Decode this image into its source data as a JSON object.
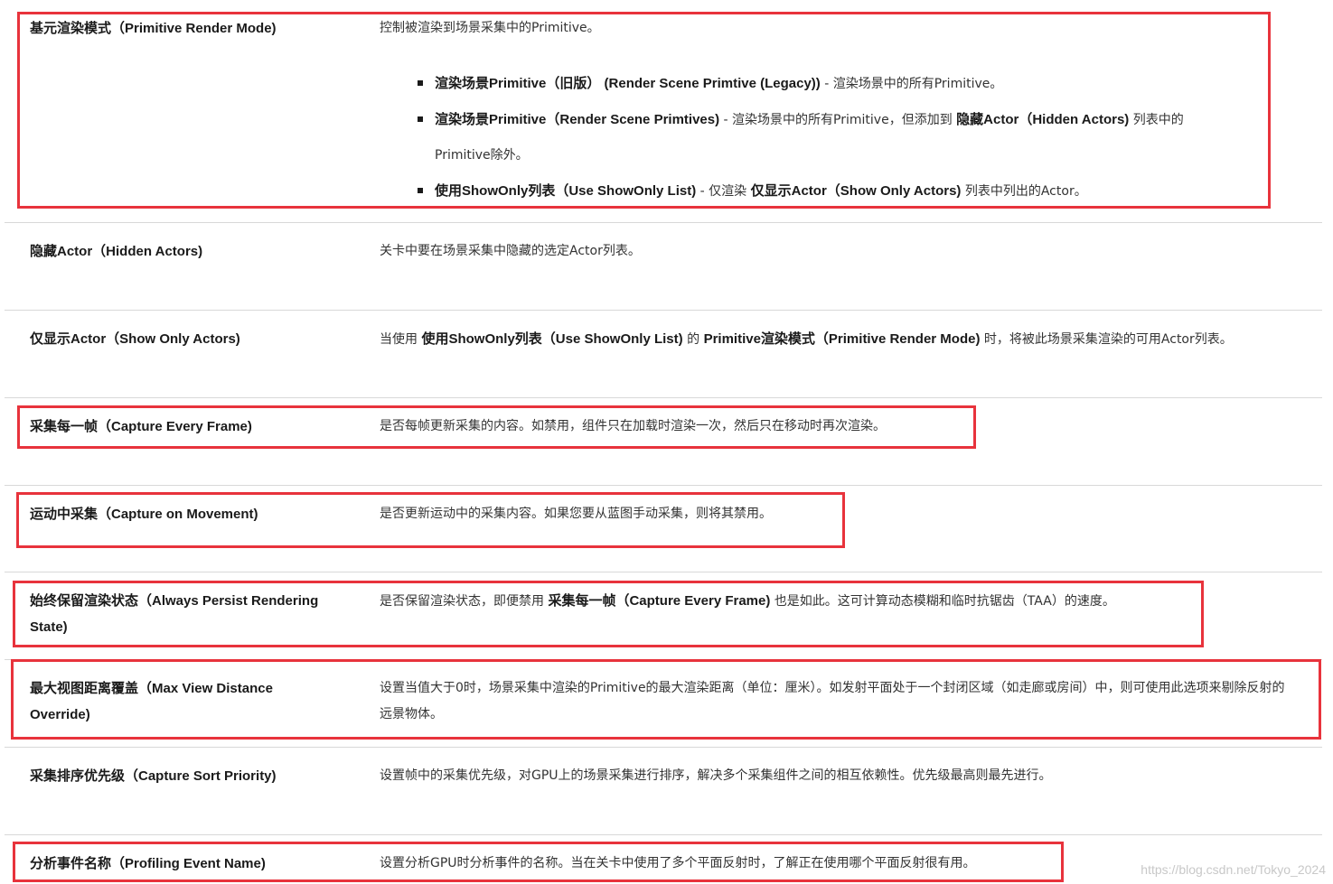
{
  "rows": [
    {
      "name": "基元渲染模式（Primitive Render Mode)",
      "desc": "控制被渲染到场景采集中的Primitive。",
      "bullets": [
        {
          "b1": "渲染场景Primitive（旧版） (Render Scene Primtive (Legacy))",
          "t1": " - 渲染场景中的所有Primitive。"
        },
        {
          "b1": "渲染场景Primitive（Render Scene Primtives)",
          "t1": " - 渲染场景中的所有Primitive，但添加到 ",
          "b2": "隐藏Actor（Hidden Actors)",
          "t2": " 列表中的",
          "t3": "Primitive除外。"
        },
        {
          "b1": "使用ShowOnly列表（Use ShowOnly List)",
          "t1": " - 仅渲染 ",
          "b2": "仅显示Actor（Show Only Actors)",
          "t2": " 列表中列出的Actor。"
        }
      ]
    },
    {
      "name": "隐藏Actor（Hidden Actors)",
      "desc": "关卡中要在场景采集中隐藏的选定Actor列表。"
    },
    {
      "name": "仅显示Actor（Show Only Actors)",
      "d1": "当使用 ",
      "b1": "使用ShowOnly列表（Use ShowOnly List)",
      "d2": " 的 ",
      "b2": "Primitive渲染模式（Primitive Render Mode)",
      "d3": " 时，将被此场景采集渲染的可用Actor列表。"
    },
    {
      "name": "采集每一帧（Capture Every Frame)",
      "desc": "是否每帧更新采集的内容。如禁用，组件只在加载时渲染一次，然后只在移动时再次渲染。"
    },
    {
      "name": "运动中采集（Capture on Movement)",
      "desc": "是否更新运动中的采集内容。如果您要从蓝图手动采集，则将其禁用。"
    },
    {
      "name": "始终保留渲染状态（Always Persist Rendering State)",
      "d1": "是否保留渲染状态，即便禁用 ",
      "b1": "采集每一帧（Capture Every Frame)",
      "d2": " 也是如此。这可计算动态模糊和临时抗锯齿（TAA）的速度。"
    },
    {
      "name": "最大视图距离覆盖（Max View Distance Override)",
      "desc": "设置当值大于0时，场景采集中渲染的Primitive的最大渲染距离（单位：厘米）。如发射平面处于一个封闭区域（如走廊或房间）中，则可使用此选项来剔除反射的远景物体。"
    },
    {
      "name": "采集排序优先级（Capture Sort Priority)",
      "desc": "设置帧中的采集优先级，对GPU上的场景采集进行排序，解决多个采集组件之间的相互依赖性。优先级最高则最先进行。"
    },
    {
      "name": "分析事件名称（Profiling Event Name)",
      "desc": "设置分析GPU时分析事件的名称。当在关卡中使用了多个平面反射时，了解正在使用哪个平面反射很有用。"
    }
  ],
  "watermark": "https://blog.csdn.net/Tokyo_2024",
  "colors": {
    "highlight": "#e8333c",
    "divider": "#d8d8d8",
    "text": "#333333"
  }
}
